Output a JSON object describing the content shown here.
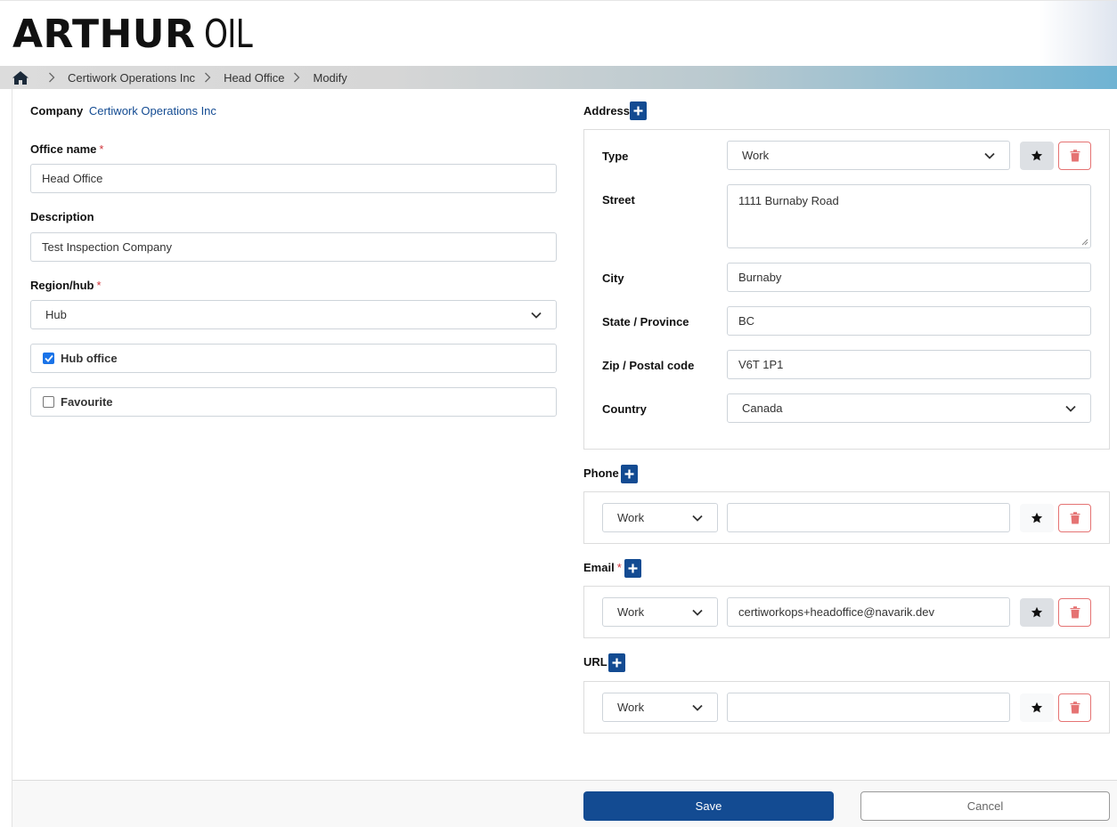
{
  "brand": {
    "logo_bold": "ARTHUR",
    "logo_light": "OIL"
  },
  "breadcrumb": {
    "home_icon": "home-icon",
    "items": [
      "Certiwork Operations Inc",
      "Head Office",
      "Modify"
    ]
  },
  "company": {
    "label": "Company",
    "value": "Certiwork Operations Inc"
  },
  "office_name": {
    "label": "Office name",
    "required_mark": "*",
    "value": "Head Office"
  },
  "description": {
    "label": "Description",
    "value": "Test Inspection Company"
  },
  "region": {
    "label": "Region/hub",
    "required_mark": "*",
    "selected": "Hub"
  },
  "hub_office": {
    "label": "Hub office",
    "checked": true
  },
  "favourite": {
    "label": "Favourite",
    "checked": false
  },
  "address": {
    "title": "Address",
    "type_label": "Type",
    "type_value": "Work",
    "street_label": "Street",
    "street_value": "1111 Burnaby Road",
    "city_label": "City",
    "city_value": "Burnaby",
    "state_label": "State / Province",
    "state_value": "BC",
    "zip_label": "Zip / Postal code",
    "zip_value": "V6T 1P1",
    "country_label": "Country",
    "country_value": "Canada"
  },
  "phone": {
    "title": "Phone",
    "type_value": "Work",
    "value": ""
  },
  "email": {
    "title": "Email",
    "required_mark": "*",
    "type_value": "Work",
    "value": "certiworkops+headoffice@navarik.dev"
  },
  "url": {
    "title": "URL",
    "type_value": "Work",
    "value": ""
  },
  "actions": {
    "save_label": "Save",
    "cancel_label": "Cancel"
  },
  "colors": {
    "primary": "#134b92",
    "link": "#134b92",
    "required": "#d0343a",
    "delete": "#e57373"
  }
}
